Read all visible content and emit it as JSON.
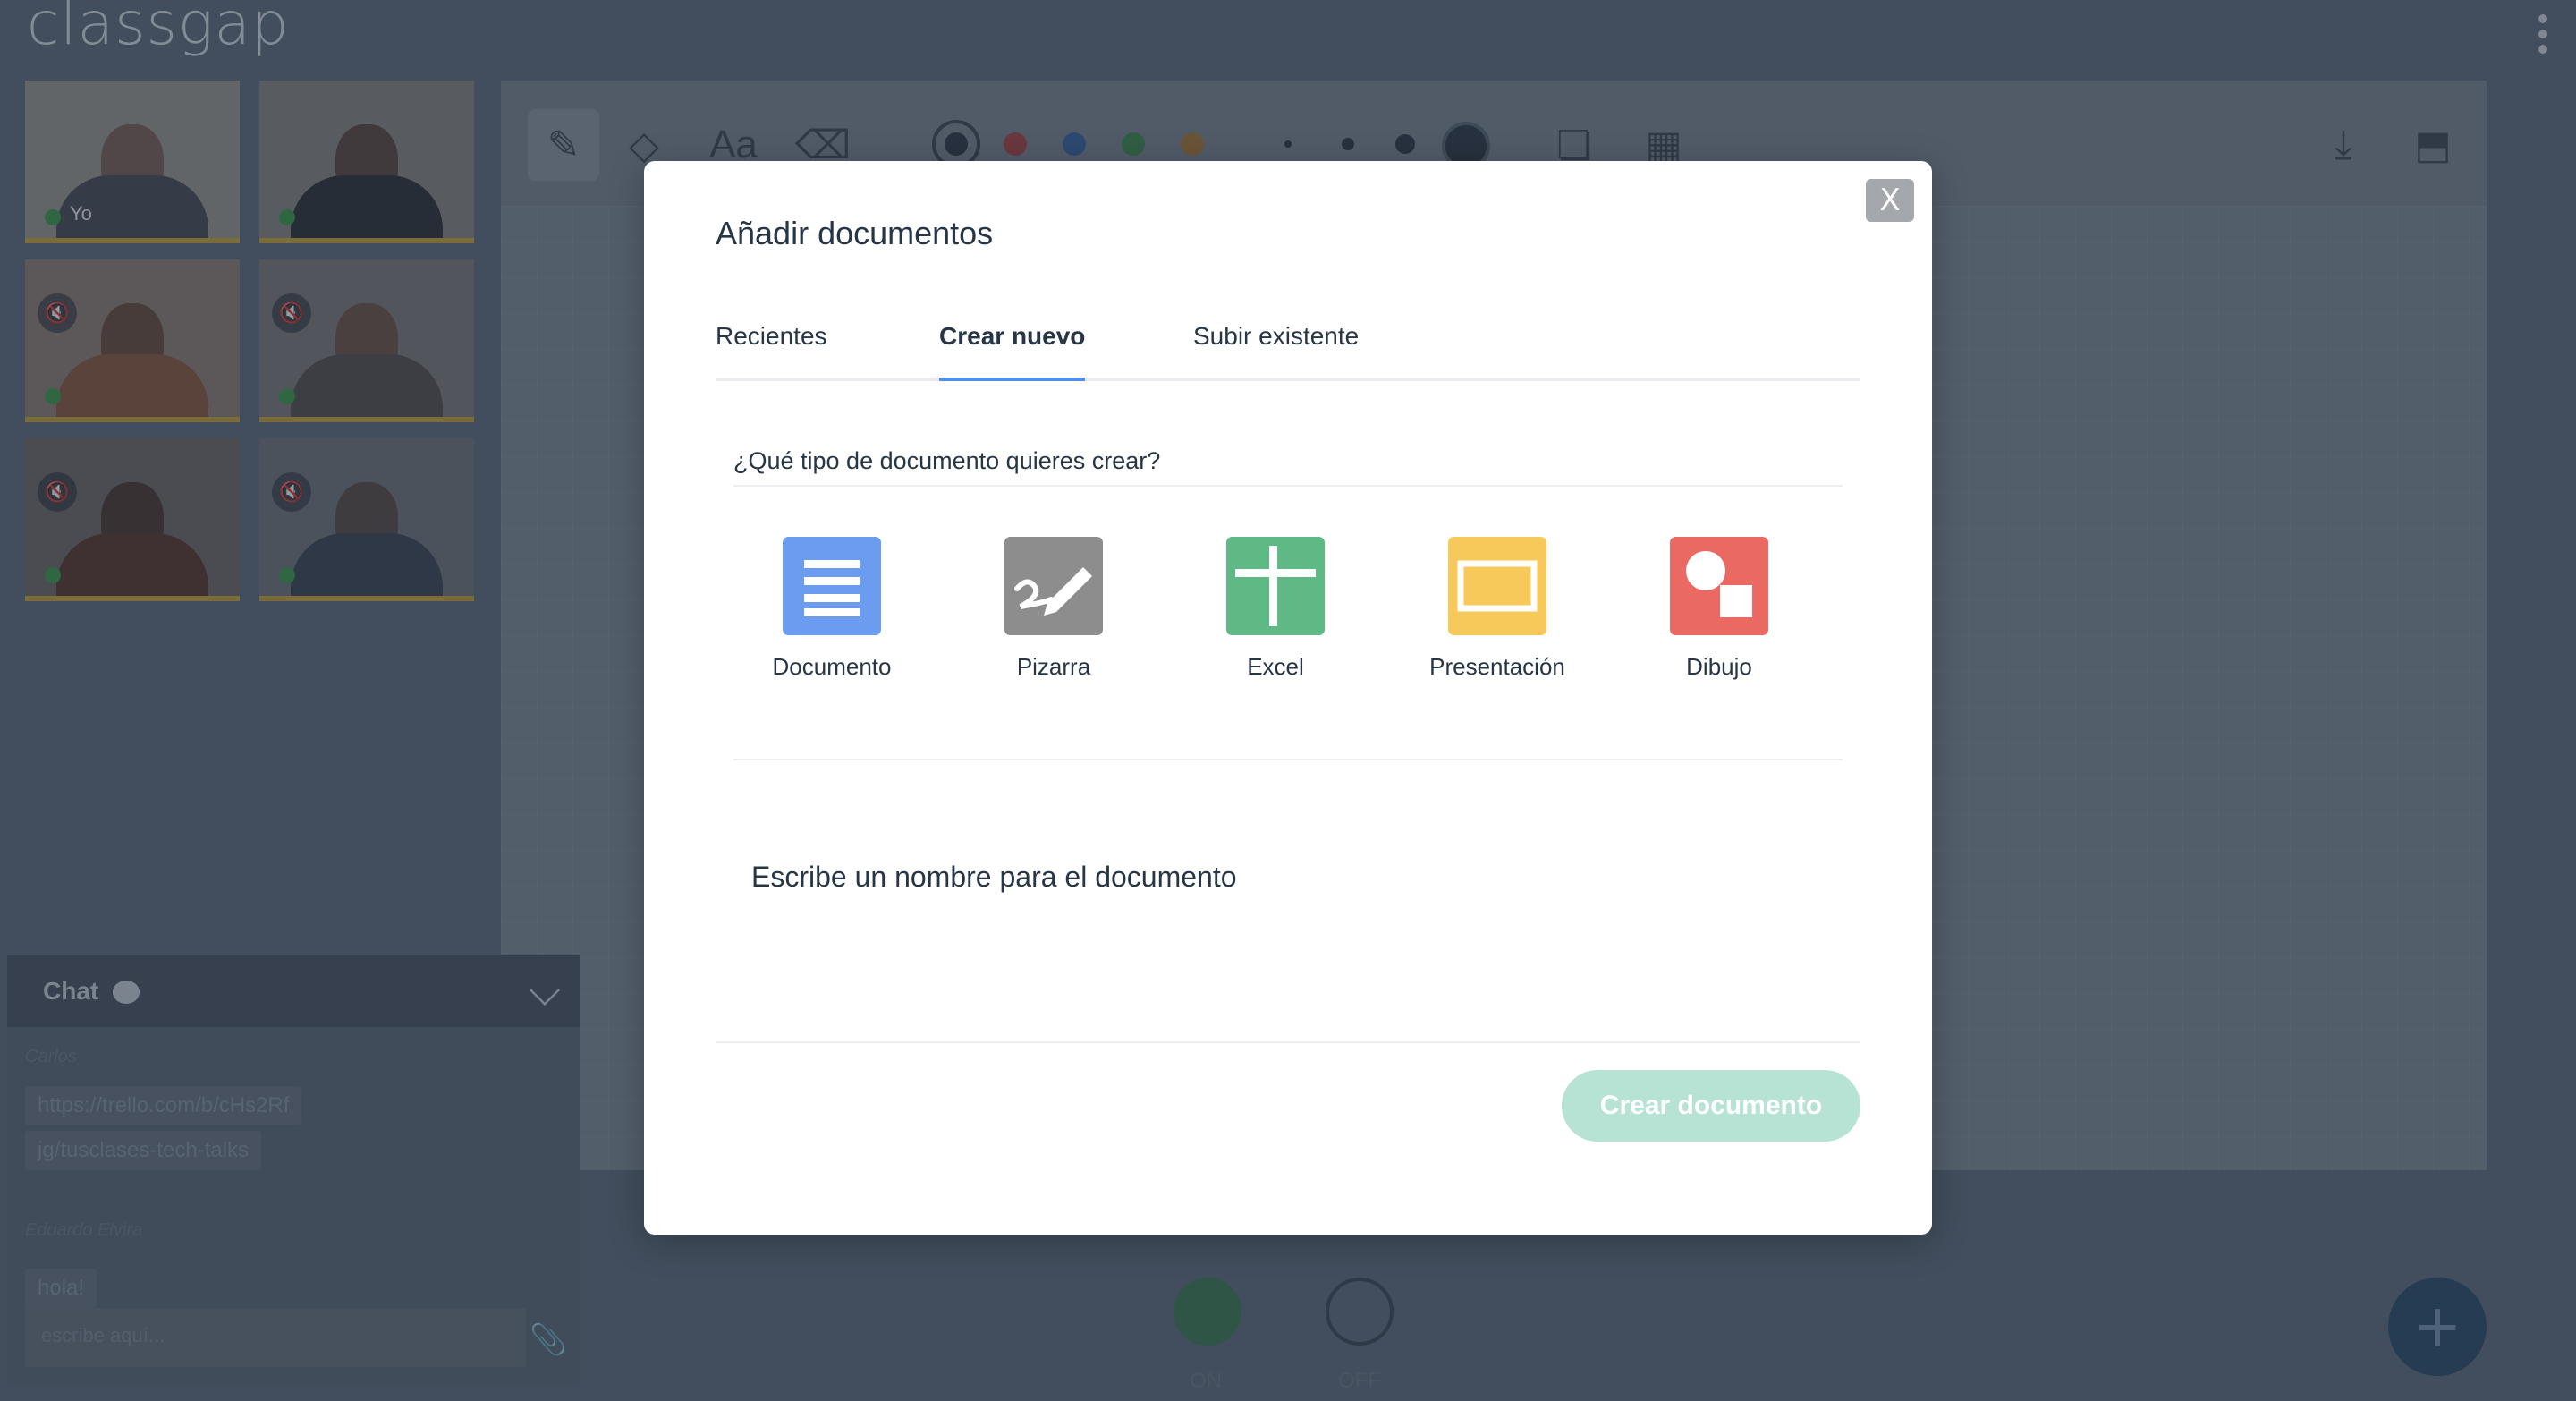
{
  "app": {
    "logo": "classgap"
  },
  "participants": [
    {
      "label": "Yo",
      "muted": false
    },
    {
      "label": "",
      "muted": false
    },
    {
      "label": "",
      "muted": true
    },
    {
      "label": "",
      "muted": true
    },
    {
      "label": "",
      "muted": true
    },
    {
      "label": "",
      "muted": true
    }
  ],
  "board": {
    "tools": [
      "pencil-icon",
      "shapes-icon",
      "text-icon",
      "eraser-icon"
    ],
    "colors": [
      "#2f3a45",
      "#c44a4a",
      "#3b6fb6",
      "#3f9b4e",
      "#c28a3a"
    ],
    "right_tools": [
      "download-icon",
      "upload-folder-icon"
    ],
    "text_tool_label": "Aa"
  },
  "chat": {
    "title": "Chat",
    "messages": [
      {
        "author": "Carlos",
        "text": "https://trello.com/b/cHs2Rf"
      },
      {
        "author": "",
        "text": "jg/tusclases-tech-talks"
      },
      {
        "author": "Eduardo Elvira",
        "text": "hola!"
      }
    ],
    "input_placeholder": "escribe aquí..."
  },
  "call_controls": {
    "camera_label": "ON",
    "mic_label": "OFF"
  },
  "modal": {
    "close_label": "X",
    "title": "Añadir documentos",
    "tabs": [
      {
        "label": "Recientes",
        "active": false
      },
      {
        "label": "Crear nuevo",
        "active": true
      },
      {
        "label": "Subir existente",
        "active": false
      }
    ],
    "question": "¿Qué tipo de documento quieres crear?",
    "types": [
      {
        "name": "Documento",
        "icon": "document-icon",
        "color": "#6b9cf0"
      },
      {
        "name": "Pizarra",
        "icon": "whiteboard-icon",
        "color": "#8d8d8d"
      },
      {
        "name": "Excel",
        "icon": "spreadsheet-icon",
        "color": "#5fb985"
      },
      {
        "name": "Presentación",
        "icon": "presentation-icon",
        "color": "#f6c95a"
      },
      {
        "name": "Dibujo",
        "icon": "drawing-icon",
        "color": "#ea6a63"
      }
    ],
    "name_placeholder": "Escribe un nombre para el documento",
    "create_button": "Crear documento"
  },
  "colors": {
    "accent_tab": "#4f8fe6",
    "create_button": "#b6e3d4"
  }
}
